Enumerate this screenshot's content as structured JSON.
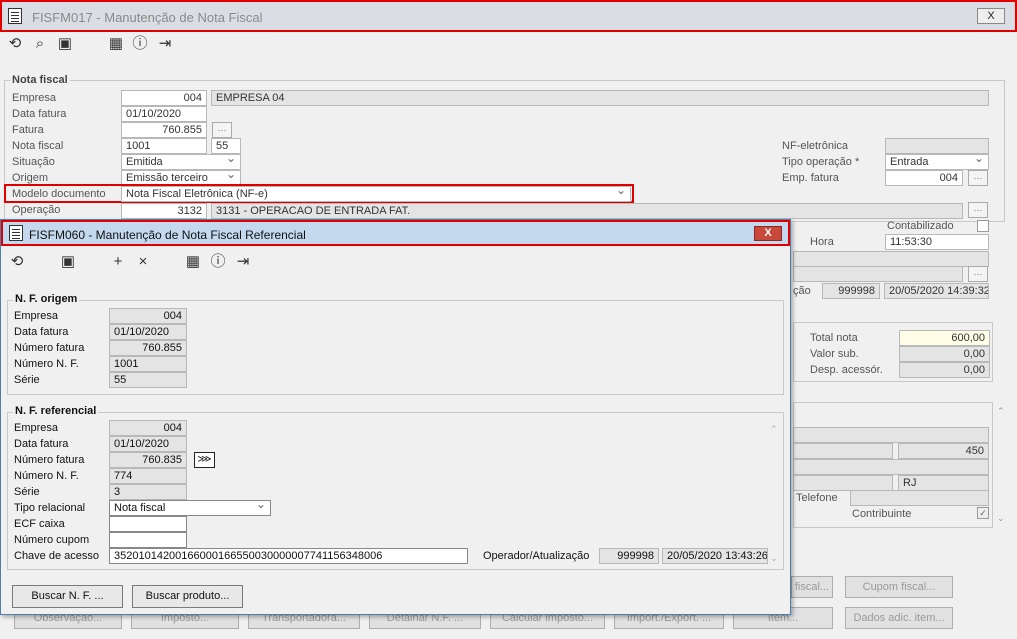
{
  "main": {
    "title": "FISFM017 - Manutenção de Nota Fiscal",
    "close": "X",
    "group_title": "Nota fiscal",
    "empresa_label": "Empresa",
    "empresa_code": "004",
    "empresa_name": "EMPRESA 04",
    "data_fatura_label": "Data fatura",
    "data_fatura": "01/10/2020",
    "fatura_label": "Fatura",
    "fatura": "760.855",
    "nota_fiscal_label": "Nota fiscal",
    "nota_fiscal": "1001",
    "serie": "55",
    "situacao_label": "Situação",
    "situacao": "Emitida",
    "origem_label": "Origem",
    "origem": "Emissão terceiro",
    "modelo_label": "Modelo documento",
    "modelo": "Nota Fiscal Eletrônica (NF-e)",
    "operacao_label": "Operação",
    "operacao_code": "3132",
    "operacao_desc": "3131 - OPERACAO DE ENTRADA FAT.",
    "nfe_label": "NF-eletrônica",
    "tipo_op_label": "Tipo operação *",
    "tipo_op": "Entrada",
    "emp_fatura_label": "Emp. fatura",
    "emp_fatura": "004",
    "contabilizado_label": "Contabilizado",
    "hora_label": "Hora",
    "hora": "11:53:30",
    "oper_partial": "ção",
    "operador": "999998",
    "atualizacao": "20/05/2020 14:39:32",
    "total_nota_label": "Total nota",
    "total_nota": "600,00",
    "valor_sub_label": "Valor sub.",
    "valor_sub": "0,00",
    "desp_label": "Desp. acessór.",
    "desp": "0,00",
    "val_450": "450",
    "uf": "RJ",
    "telefone_label": "Telefone",
    "contribuinte_label": "Contribuinte",
    "btn_fiscal": "fiscal...",
    "btn_cupom": "Cupom fiscal...",
    "btn_observacao": "Observação...",
    "btn_imposto": "Imposto...",
    "btn_transportadora": "Transportadora...",
    "btn_detalhar": "Detalhar N.F. ...",
    "btn_calcular": "Calcular imposto...",
    "btn_import": "Import./Export. ...",
    "btn_item": "Item...",
    "btn_dados": "Dados adic. item..."
  },
  "modal": {
    "title": "FISFM060 - Manutenção de Nota Fiscal Referencial",
    "close": "X",
    "origem_title": "N. F. origem",
    "empresa_label": "Empresa",
    "o_empresa": "004",
    "data_fatura_label": "Data fatura",
    "o_data_fatura": "01/10/2020",
    "numero_fatura_label": "Número fatura",
    "o_numero_fatura": "760.855",
    "numero_nf_label": "Número N. F.",
    "o_numero_nf": "1001",
    "serie_label": "Série",
    "o_serie": "55",
    "ref_title": "N. F. referencial",
    "r_empresa": "004",
    "r_data_fatura": "01/10/2020",
    "r_numero_fatura": "760.835",
    "r_numero_nf": "774",
    "r_serie": "3",
    "tipo_relacional_label": "Tipo relacional",
    "tipo_relacional": "Nota fiscal",
    "ecf_label": "ECF caixa",
    "ecf": "",
    "cupom_label": "Número cupom",
    "cupom": "",
    "chave_label": "Chave de acesso",
    "chave": "35201014200166000166550030000007741156348006",
    "oper_label": "Operador/Atualização",
    "operador": "999998",
    "atualizacao": "20/05/2020 13:43:26",
    "btn_buscar_nf": "Buscar N. F. ...",
    "btn_buscar_produto": "Buscar produto..."
  }
}
